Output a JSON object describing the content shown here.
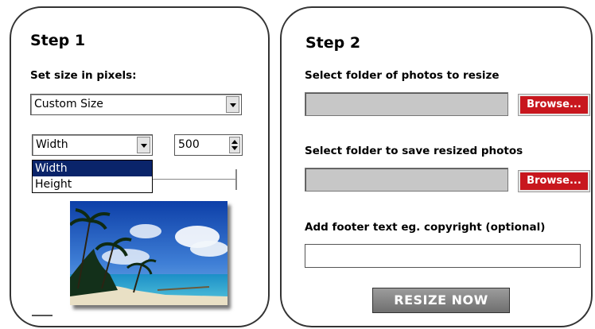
{
  "step1": {
    "title": "Step 1",
    "size_label": "Set size in pixels:",
    "size_preset": "Custom Size",
    "dimension": "Width",
    "dimension_options": [
      "Width",
      "Height"
    ],
    "pixel_value": "500"
  },
  "step2": {
    "title": "Step 2",
    "source_label": "Select folder of photos to resize",
    "source_browse": "Browse...",
    "dest_label": "Select folder to save resized photos",
    "dest_browse": "Browse...",
    "footer_label": "Add footer text eg. copyright (optional)",
    "footer_value": "",
    "resize_button": "RESIZE NOW"
  },
  "colors": {
    "browse_button": "#c8171e",
    "dropdown_highlight": "#0a246a",
    "path_field": "#c7c7c7"
  }
}
